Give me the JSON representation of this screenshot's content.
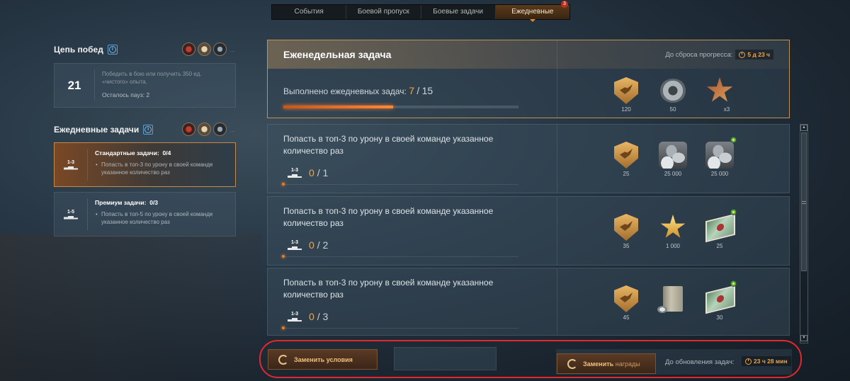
{
  "tabs": [
    {
      "label": "События",
      "active": false
    },
    {
      "label": "Боевой пропуск",
      "active": false
    },
    {
      "label": "Боевые задачи",
      "active": false
    },
    {
      "label": "Ежедневные",
      "active": true,
      "badge": "3"
    }
  ],
  "sidebar": {
    "chain": {
      "title": "Цепь побед",
      "info_icon": "i",
      "medal_icons": [
        "medal-red-icon",
        "medal-white-icon",
        "medal-dark-icon"
      ],
      "more": "...",
      "count": "21",
      "description": "Победить в бою или получить 350 ед. «чистого» опыта.",
      "pauses": "Осталось пауз: 2"
    },
    "daily": {
      "title": "Ежедневные задачи",
      "info_icon": "i",
      "more": "...",
      "standard": {
        "podium": "1-3",
        "title": "Стандартные задачи:",
        "count": "0/4",
        "bullet": "Попасть в топ-3 по урону в своей команде указанное количество раз"
      },
      "premium": {
        "podium": "1-5",
        "title": "Премиум задачи:",
        "count": "0/3",
        "bullet": "Попасть в топ-5 по урону в своей команде указанное количество раз"
      }
    }
  },
  "weekly": {
    "title": "Еженедельная задача",
    "reset_label": "До сброса прогресса:",
    "reset_time": "5 д 23 ч",
    "progress_label": "Выполнено ежедневных задач:",
    "progress_current": "7",
    "progress_sep": "/",
    "progress_total": "15",
    "progress_fraction": 0.467,
    "rewards": [
      {
        "icon": "shield-points-icon",
        "value": "120"
      },
      {
        "icon": "gear-parts-icon",
        "value": "50"
      },
      {
        "icon": "stars-crew-icon",
        "value": "x3"
      }
    ]
  },
  "quests": [
    {
      "title": "Попасть в топ-3 по урону в своей команде указанное количество раз",
      "podium": "1-3",
      "current": "0",
      "sep": "/",
      "total": "1",
      "rewards": [
        {
          "icon": "shield-points-icon",
          "value": "25"
        },
        {
          "icon": "silver-coins-icon",
          "value": "25 000"
        },
        {
          "icon": "silver-coins-icon",
          "value": "25 000",
          "bonus": true
        }
      ]
    },
    {
      "title": "Попасть в топ-3 по урону в своей команде указанное количество раз",
      "podium": "1-3",
      "current": "0",
      "sep": "/",
      "total": "2",
      "rewards": [
        {
          "icon": "shield-points-icon",
          "value": "35"
        },
        {
          "icon": "free-xp-star-icon",
          "value": "1 000"
        },
        {
          "icon": "credits-cash-icon",
          "value": "25",
          "bonus": true
        }
      ]
    },
    {
      "title": "Попасть в топ-3 по урону в своей команде указанное количество раз",
      "podium": "1-3",
      "current": "0",
      "sep": "/",
      "total": "3",
      "rewards": [
        {
          "icon": "shield-points-icon",
          "value": "45"
        },
        {
          "icon": "book-coins-icon",
          "value": ""
        },
        {
          "icon": "credits-cash-icon",
          "value": "30",
          "bonus": true
        }
      ]
    }
  ],
  "bottom": {
    "replace_conditions": "Заменить условия",
    "replace_rewards": "Заменить",
    "replace_rewards_sub": "награды",
    "update_label": "До обновления задач:",
    "update_time": "23 ч 28 мин"
  }
}
